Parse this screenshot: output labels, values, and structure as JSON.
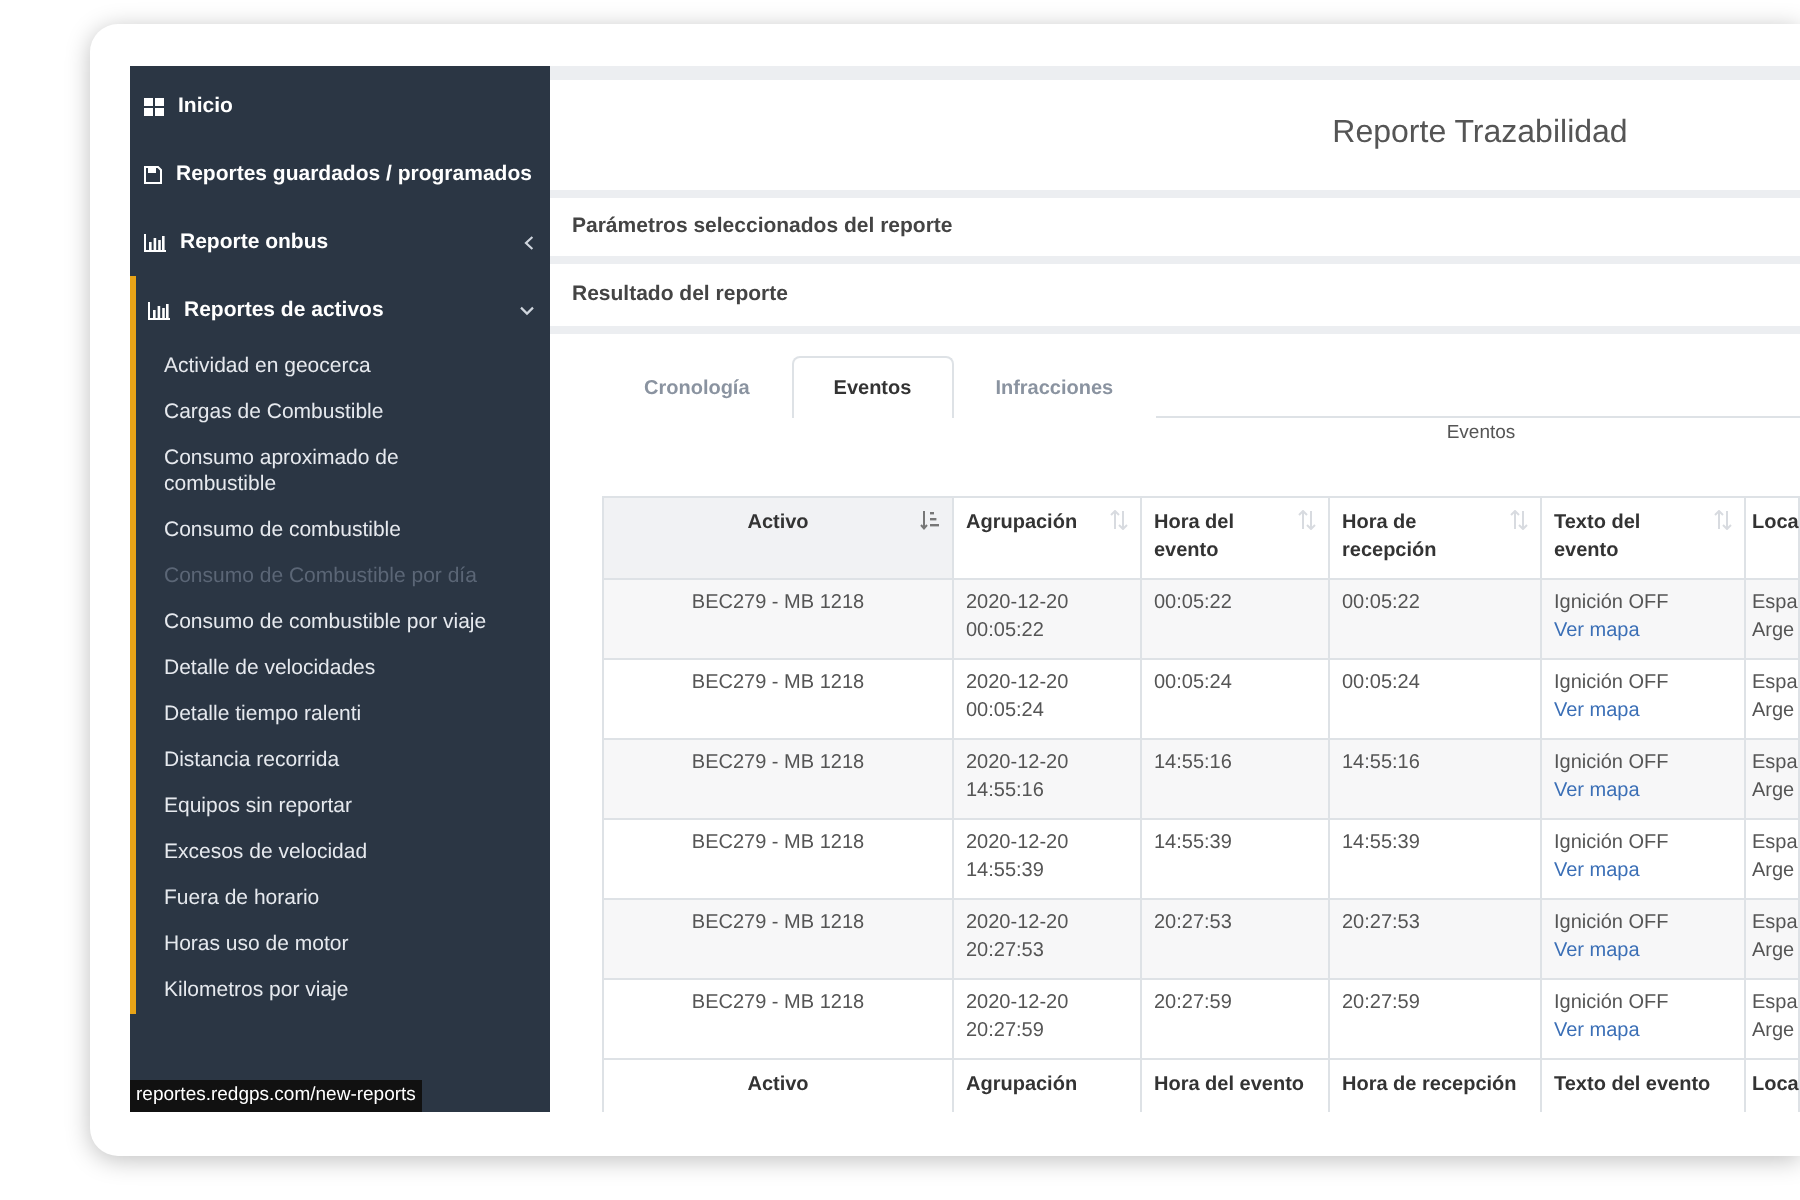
{
  "sidebar": {
    "items": [
      {
        "label": "Inicio"
      },
      {
        "label": "Reportes guardados / programados"
      },
      {
        "label": "Reporte onbus",
        "expanded": false
      },
      {
        "label": "Reportes de activos",
        "expanded": true,
        "children": [
          {
            "label": "Actividad en geocerca",
            "disabled": false
          },
          {
            "label": "Cargas de Combustible",
            "disabled": false
          },
          {
            "label": "Consumo aproximado de combustible",
            "disabled": false
          },
          {
            "label": "Consumo de combustible",
            "disabled": false
          },
          {
            "label": "Consumo de Combustible por día",
            "disabled": true
          },
          {
            "label": "Consumo de combustible por viaje",
            "disabled": false
          },
          {
            "label": "Detalle de velocidades",
            "disabled": false
          },
          {
            "label": "Detalle tiempo ralenti",
            "disabled": false
          },
          {
            "label": "Distancia recorrida",
            "disabled": false
          },
          {
            "label": "Equipos sin reportar",
            "disabled": false
          },
          {
            "label": "Excesos de velocidad",
            "disabled": false
          },
          {
            "label": "Fuera de horario",
            "disabled": false
          },
          {
            "label": "Horas uso de motor",
            "disabled": false
          },
          {
            "label": "Kilometros por viaje",
            "disabled": false
          }
        ]
      }
    ]
  },
  "status_link": "reportes.redgps.com/new-reports",
  "main": {
    "title": "Reporte Trazabilidad",
    "sections": [
      "Parámetros seleccionados del reporte",
      "Resultado del reporte"
    ],
    "tabs": [
      {
        "label": "Cronología",
        "selected": false
      },
      {
        "label": "Eventos",
        "selected": true
      },
      {
        "label": "Infracciones",
        "selected": false
      }
    ],
    "table_caption": "Eventos",
    "table": {
      "columns": [
        {
          "label": "Activo",
          "sorted": true
        },
        {
          "label": "Agrupación",
          "sorted": false
        },
        {
          "label": "Hora del evento",
          "sorted": false
        },
        {
          "label": "Hora de recepción",
          "sorted": false
        },
        {
          "label": "Texto del evento",
          "sorted": false
        },
        {
          "label": "Loca"
        }
      ],
      "rows": [
        {
          "activo": "BEC279 - MB 1218",
          "agrupacion": "2020-12-20 00:05:22",
          "hora_evento": "00:05:22",
          "hora_recepcion": "00:05:22",
          "texto": "Ignición OFF",
          "link": "Ver mapa",
          "column_6": [
            "Espa",
            "Arge"
          ]
        },
        {
          "activo": "BEC279 - MB 1218",
          "agrupacion": "2020-12-20 00:05:24",
          "hora_evento": "00:05:24",
          "hora_recepcion": "00:05:24",
          "texto": "Ignición OFF",
          "link": "Ver mapa",
          "column_6": [
            "Espa",
            "Arge"
          ]
        },
        {
          "activo": "BEC279 - MB 1218",
          "agrupacion": "2020-12-20 14:55:16",
          "hora_evento": "14:55:16",
          "hora_recepcion": "14:55:16",
          "texto": "Ignición OFF",
          "link": "Ver mapa",
          "column_6": [
            "Espa",
            "Arge"
          ]
        },
        {
          "activo": "BEC279 - MB 1218",
          "agrupacion": "2020-12-20 14:55:39",
          "hora_evento": "14:55:39",
          "hora_recepcion": "14:55:39",
          "texto": "Ignición OFF",
          "link": "Ver mapa",
          "column_6": [
            "Espa",
            "Arge"
          ]
        },
        {
          "activo": "BEC279 - MB 1218",
          "agrupacion": "2020-12-20 20:27:53",
          "hora_evento": "20:27:53",
          "hora_recepcion": "20:27:53",
          "texto": "Ignición OFF",
          "link": "Ver mapa",
          "column_6": [
            "Espa",
            "Arge"
          ]
        },
        {
          "activo": "BEC279 - MB 1218",
          "agrupacion": "2020-12-20 20:27:59",
          "hora_evento": "20:27:59",
          "hora_recepcion": "20:27:59",
          "texto": "Ignición OFF",
          "link": "Ver mapa",
          "column_6": [
            "Espa",
            "Arge"
          ]
        }
      ],
      "footer": [
        "Activo",
        "Agrupación",
        "Hora del evento",
        "Hora de recepción",
        "Texto del evento",
        "Loca"
      ]
    }
  }
}
